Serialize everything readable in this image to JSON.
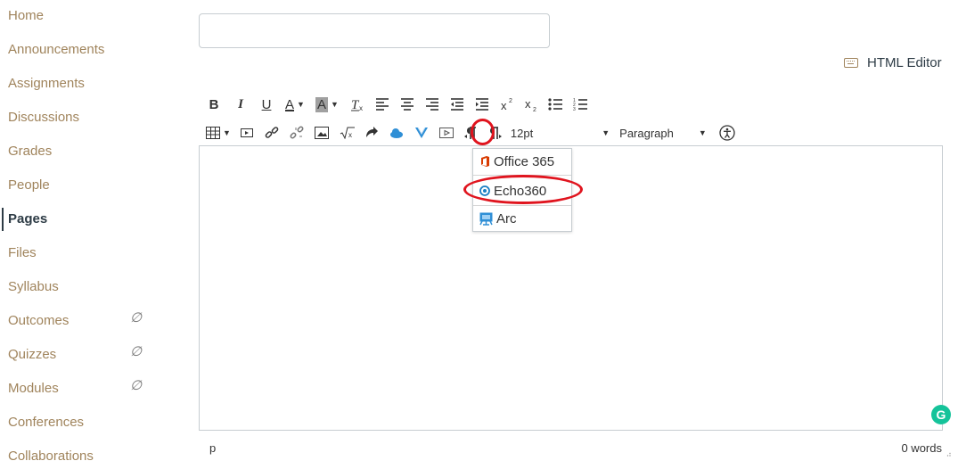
{
  "sidebar": {
    "items": [
      {
        "label": "Home",
        "hidden": false
      },
      {
        "label": "Announcements",
        "hidden": false
      },
      {
        "label": "Assignments",
        "hidden": false
      },
      {
        "label": "Discussions",
        "hidden": false
      },
      {
        "label": "Grades",
        "hidden": false
      },
      {
        "label": "People",
        "hidden": false
      },
      {
        "label": "Pages",
        "hidden": false,
        "active": true
      },
      {
        "label": "Files",
        "hidden": false
      },
      {
        "label": "Syllabus",
        "hidden": false
      },
      {
        "label": "Outcomes",
        "hidden": true
      },
      {
        "label": "Quizzes",
        "hidden": true
      },
      {
        "label": "Modules",
        "hidden": true
      },
      {
        "label": "Conferences",
        "hidden": false
      },
      {
        "label": "Collaborations",
        "hidden": false
      }
    ],
    "hidden_icon": "∅"
  },
  "title_input": {
    "value": "",
    "placeholder": ""
  },
  "html_editor": {
    "label": "HTML Editor",
    "icon": "keyboard-icon"
  },
  "toolbar": {
    "bold": "B",
    "italic": "I",
    "underline": "U",
    "text_color": "A",
    "background_color": "A",
    "font_size": "12pt",
    "format": "Paragraph"
  },
  "tool_menu": {
    "items": [
      {
        "label": "Office 365",
        "icon": "office-365-icon",
        "color": "#d83b01"
      },
      {
        "label": "Echo360",
        "icon": "echo360-icon",
        "color": "#1b7fc3"
      },
      {
        "label": "Arc",
        "icon": "arc-icon",
        "color": "#2f8fd6"
      }
    ]
  },
  "status": {
    "path": "p",
    "word_count": "0 words"
  },
  "colors": {
    "accent": "#a0845c",
    "text": "#2d3b45",
    "annotation": "#e0141e"
  }
}
